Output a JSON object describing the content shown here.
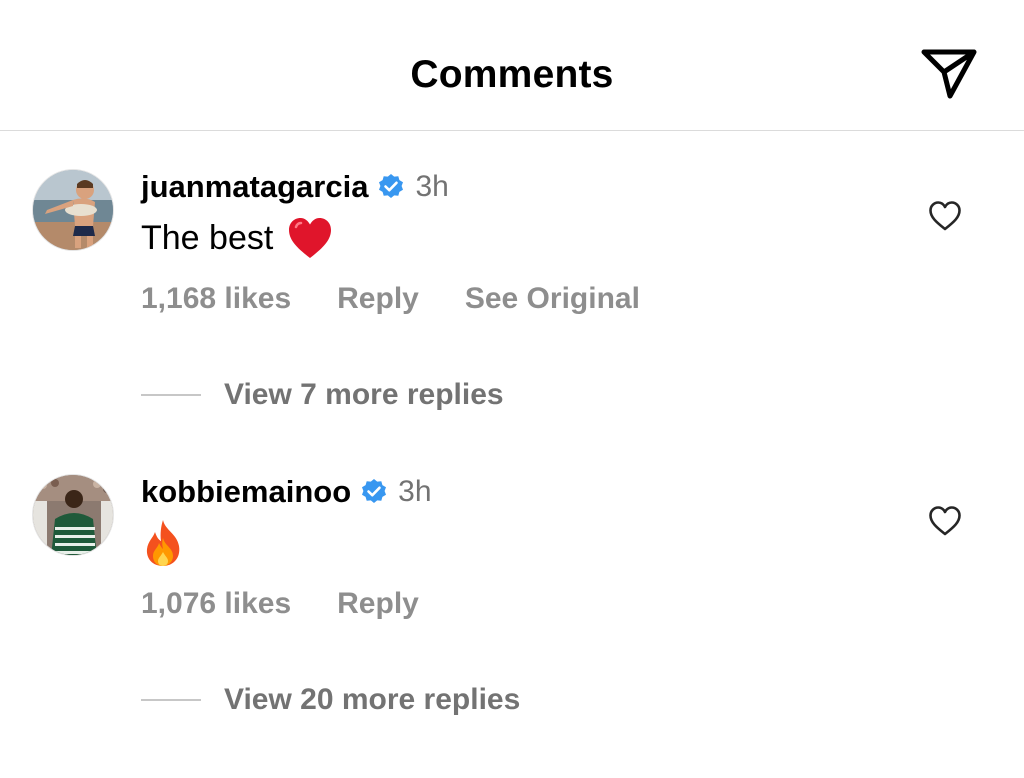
{
  "header": {
    "title": "Comments",
    "share_icon": "paper-plane-icon"
  },
  "comments": [
    {
      "username": "juanmatagarcia",
      "verified": true,
      "time": "3h",
      "text": "The best",
      "emoji": "red-heart-emoji",
      "likes": "1,168 likes",
      "reply_label": "Reply",
      "see_original_label": "See Original",
      "view_replies": "View 7 more replies",
      "avatar_icon": "avatar-child-beach"
    },
    {
      "username": "kobbiemainoo",
      "verified": true,
      "time": "3h",
      "text": "",
      "emoji": "fire-emoji",
      "likes": "1,076 likes",
      "reply_label": "Reply",
      "view_replies": "View 20 more replies",
      "avatar_icon": "avatar-footballer"
    }
  ],
  "colors": {
    "verified_blue": "#3897f0",
    "secondary_text": "#8e8e8e",
    "divider": "#dbdbdb"
  }
}
